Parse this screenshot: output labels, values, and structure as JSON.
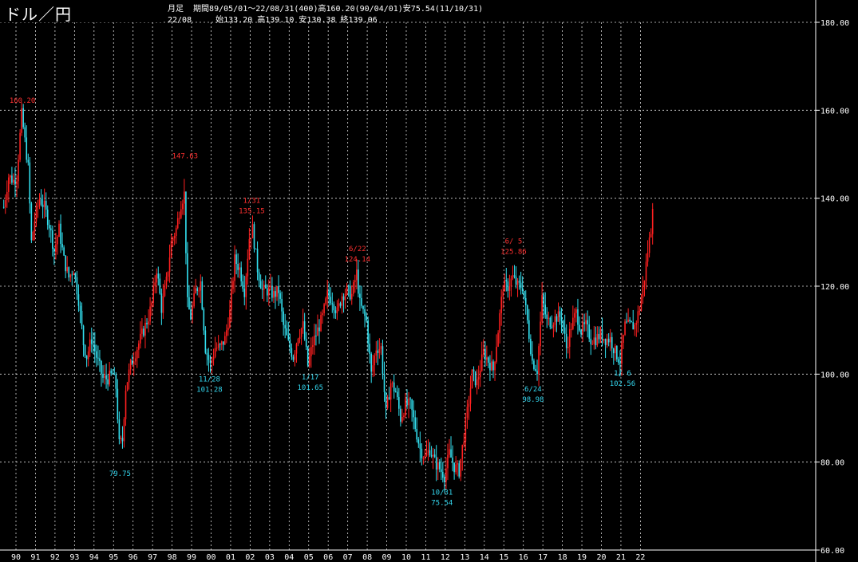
{
  "header": {
    "title": "ドル／円",
    "period_type": "月足",
    "summary": "期間89/05/01～22/08/31(400)高160.20(90/04/01)安75.54(11/10/31)",
    "last_bar": "22/08　　　始133.20 高139.10 安130.38 終139.06"
  },
  "colors": {
    "background": "#000000",
    "up": "#ff2020",
    "down": "#33e0f0",
    "grid": "#ffffff",
    "label_high": "#ff3030",
    "label_low": "#33d6ee"
  },
  "chart_data": {
    "type": "candlestick",
    "title": "ドル／円",
    "x_tick_labels": [
      "90",
      "91",
      "92",
      "93",
      "94",
      "95",
      "96",
      "97",
      "98",
      "99",
      "00",
      "01",
      "02",
      "03",
      "04",
      "05",
      "06",
      "07",
      "08",
      "09",
      "10",
      "11",
      "12",
      "13",
      "14",
      "15",
      "16",
      "17",
      "18",
      "19",
      "20",
      "21",
      "22"
    ],
    "x_tick_years": [
      1990,
      1991,
      1992,
      1993,
      1994,
      1995,
      1996,
      1997,
      1998,
      1999,
      2000,
      2001,
      2002,
      2003,
      2004,
      2005,
      2006,
      2007,
      2008,
      2009,
      2010,
      2011,
      2012,
      2013,
      2014,
      2015,
      2016,
      2017,
      2018,
      2019,
      2020,
      2021,
      2022
    ],
    "y_ticks": [
      60,
      80,
      100,
      120,
      140,
      160,
      180
    ],
    "y_tick_labels": [
      "60.00",
      "80.00",
      "100.00",
      "120.00",
      "140.00",
      "160.00",
      "180.00"
    ],
    "ylim": [
      60,
      180
    ],
    "x_range": [
      "1989-05",
      "2022-08"
    ],
    "grid": true,
    "series": [
      {
        "values_note": "monthly closes read from chart",
        "points": [
          [
            "1989-05",
            138
          ],
          [
            "1989-08",
            145
          ],
          [
            "1989-11",
            144
          ],
          [
            "1990-01",
            145
          ],
          [
            "1990-04",
            159
          ],
          [
            "1990-06",
            153
          ],
          [
            "1990-08",
            147
          ],
          [
            "1990-10",
            130
          ],
          [
            "1990-12",
            135
          ],
          [
            "1991-03",
            140
          ],
          [
            "1991-06",
            138
          ],
          [
            "1991-09",
            134
          ],
          [
            "1991-12",
            128
          ],
          [
            "1992-03",
            133
          ],
          [
            "1992-06",
            126
          ],
          [
            "1992-09",
            122
          ],
          [
            "1992-12",
            124
          ],
          [
            "1993-03",
            117
          ],
          [
            "1993-06",
            107
          ],
          [
            "1993-08",
            104
          ],
          [
            "1993-11",
            108
          ],
          [
            "1994-02",
            104
          ],
          [
            "1994-06",
            99
          ],
          [
            "1994-09",
            99
          ],
          [
            "1994-12",
            100
          ],
          [
            "1995-02",
            97
          ],
          [
            "1995-04",
            84
          ],
          [
            "1995-06",
            85
          ],
          [
            "1995-08",
            97
          ],
          [
            "1995-11",
            102
          ],
          [
            "1996-02",
            105
          ],
          [
            "1996-06",
            109
          ],
          [
            "1996-10",
            113
          ],
          [
            "1996-12",
            116
          ],
          [
            "1997-03",
            124
          ],
          [
            "1997-06",
            115
          ],
          [
            "1997-09",
            121
          ],
          [
            "1997-12",
            130
          ],
          [
            "1998-03",
            133
          ],
          [
            "1998-06",
            139
          ],
          [
            "1998-08",
            141
          ],
          [
            "1998-10",
            116
          ],
          [
            "1998-12",
            113
          ],
          [
            "1999-03",
            119
          ],
          [
            "1999-06",
            121
          ],
          [
            "1999-09",
            106
          ],
          [
            "1999-12",
            102
          ],
          [
            "2000-03",
            106
          ],
          [
            "2000-06",
            106
          ],
          [
            "2000-09",
            108
          ],
          [
            "2000-12",
            114
          ],
          [
            "2001-03",
            126
          ],
          [
            "2001-06",
            124
          ],
          [
            "2001-09",
            119
          ],
          [
            "2001-12",
            131
          ],
          [
            "2002-02",
            133
          ],
          [
            "2002-05",
            124
          ],
          [
            "2002-08",
            119
          ],
          [
            "2002-12",
            119
          ],
          [
            "2003-03",
            118
          ],
          [
            "2003-06",
            119
          ],
          [
            "2003-09",
            111
          ],
          [
            "2003-12",
            107
          ],
          [
            "2004-03",
            104
          ],
          [
            "2004-06",
            109
          ],
          [
            "2004-09",
            111
          ],
          [
            "2004-12",
            102
          ],
          [
            "2005-03",
            107
          ],
          [
            "2005-06",
            110
          ],
          [
            "2005-09",
            113
          ],
          [
            "2005-12",
            118
          ],
          [
            "2006-03",
            117
          ],
          [
            "2006-06",
            114
          ],
          [
            "2006-09",
            118
          ],
          [
            "2006-12",
            119
          ],
          [
            "2007-03",
            118
          ],
          [
            "2007-06",
            123
          ],
          [
            "2007-08",
            116
          ],
          [
            "2007-12",
            112
          ],
          [
            "2008-03",
            100
          ],
          [
            "2008-06",
            106
          ],
          [
            "2008-09",
            106
          ],
          [
            "2008-12",
            91
          ],
          [
            "2009-03",
            98
          ],
          [
            "2009-06",
            96
          ],
          [
            "2009-09",
            90
          ],
          [
            "2009-12",
            93
          ],
          [
            "2010-03",
            93
          ],
          [
            "2010-06",
            88
          ],
          [
            "2010-09",
            83
          ],
          [
            "2010-12",
            81
          ],
          [
            "2011-03",
            83
          ],
          [
            "2011-06",
            80
          ],
          [
            "2011-10",
            78
          ],
          [
            "2011-12",
            77
          ],
          [
            "2012-03",
            82
          ],
          [
            "2012-06",
            79
          ],
          [
            "2012-09",
            78
          ],
          [
            "2012-12",
            86
          ],
          [
            "2013-03",
            94
          ],
          [
            "2013-05",
            100
          ],
          [
            "2013-08",
            98
          ],
          [
            "2013-12",
            105
          ],
          [
            "2014-03",
            103
          ],
          [
            "2014-06",
            101
          ],
          [
            "2014-09",
            110
          ],
          [
            "2014-12",
            120
          ],
          [
            "2015-03",
            120
          ],
          [
            "2015-06",
            122
          ],
          [
            "2015-09",
            120
          ],
          [
            "2015-12",
            120
          ],
          [
            "2016-03",
            112
          ],
          [
            "2016-06",
            103
          ],
          [
            "2016-09",
            101
          ],
          [
            "2016-12",
            117
          ],
          [
            "2017-03",
            112
          ],
          [
            "2017-06",
            112
          ],
          [
            "2017-09",
            113
          ],
          [
            "2017-12",
            113
          ],
          [
            "2018-03",
            106
          ],
          [
            "2018-06",
            111
          ],
          [
            "2018-09",
            114
          ],
          [
            "2018-12",
            110
          ],
          [
            "2019-03",
            111
          ],
          [
            "2019-06",
            108
          ],
          [
            "2019-09",
            108
          ],
          [
            "2019-12",
            109
          ],
          [
            "2020-03",
            108
          ],
          [
            "2020-06",
            108
          ],
          [
            "2020-09",
            105
          ],
          [
            "2020-12",
            103
          ],
          [
            "2021-03",
            111
          ],
          [
            "2021-06",
            111
          ],
          [
            "2021-09",
            111
          ],
          [
            "2021-12",
            115
          ],
          [
            "2022-03",
            122
          ],
          [
            "2022-05",
            128
          ],
          [
            "2022-07",
            133
          ],
          [
            "2022-08",
            139
          ]
        ]
      }
    ],
    "annotations": [
      {
        "kind": "high",
        "date": "1990-04",
        "lines": [
          "160.20"
        ],
        "value": 160.2
      },
      {
        "kind": "low",
        "date": "1995-04",
        "lines": [
          "79.75"
        ],
        "value": 79.75
      },
      {
        "kind": "high",
        "date": "1998-08",
        "lines": [
          "147.63"
        ],
        "value": 147.63
      },
      {
        "kind": "low",
        "date": "1999-11",
        "lines": [
          "11/28",
          "101.28"
        ],
        "value": 101.28
      },
      {
        "kind": "high",
        "date": "2002-01",
        "lines": [
          "1/31",
          "135.15"
        ],
        "value": 135.15
      },
      {
        "kind": "low",
        "date": "2005-01",
        "lines": [
          "1/17",
          "101.65"
        ],
        "value": 101.65
      },
      {
        "kind": "high",
        "date": "2007-06",
        "lines": [
          "6/22",
          "124.14"
        ],
        "value": 124.14
      },
      {
        "kind": "low",
        "date": "2011-10",
        "lines": [
          "10/31",
          "75.54"
        ],
        "value": 75.54
      },
      {
        "kind": "high",
        "date": "2015-06",
        "lines": [
          "6/ 5",
          "125.86"
        ],
        "value": 125.86
      },
      {
        "kind": "low",
        "date": "2016-06",
        "lines": [
          "6/24",
          "98.98"
        ],
        "value": 98.98
      },
      {
        "kind": "low",
        "date": "2021-01",
        "lines": [
          "1/ 6",
          "102.56"
        ],
        "value": 102.56
      }
    ]
  }
}
